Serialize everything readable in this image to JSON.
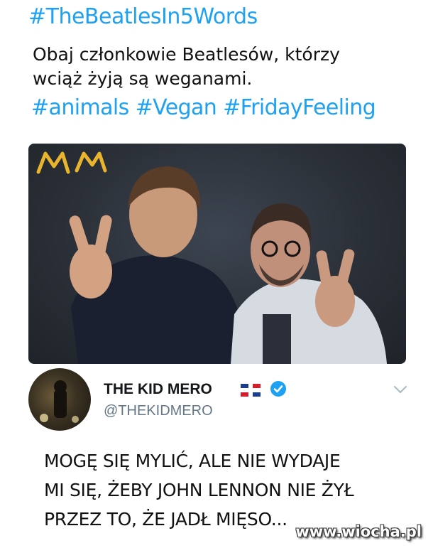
{
  "tweet": {
    "hashtag_top": "#TheBeatlesIn5Words",
    "text_line1": "Obaj członkowie Beatlesów, którzy",
    "text_line2": "wciąż żyją są weganami.",
    "hashtags": "#animals #Vegan #FridayFeeling"
  },
  "reply": {
    "display_name": "THE KID MERO",
    "handle": "@THEKIDMERO",
    "text_line1": "MOGĘ SIĘ MYLIĆ, ALE NIE WYDAJE",
    "text_line2": "MI SIĘ, ŻEBY JOHN LENNON NIE ŻYŁ",
    "text_line3": "PRZEZ TO, ŻE JADŁ MIĘSO..."
  },
  "watermark": "www.wiocha.pl",
  "icons": [
    "flag-icon",
    "verified-icon",
    "chevron-down-icon"
  ],
  "colors": {
    "hashtag": "#1da1f2",
    "verified": "#1da1f2",
    "handle": "#657786"
  }
}
